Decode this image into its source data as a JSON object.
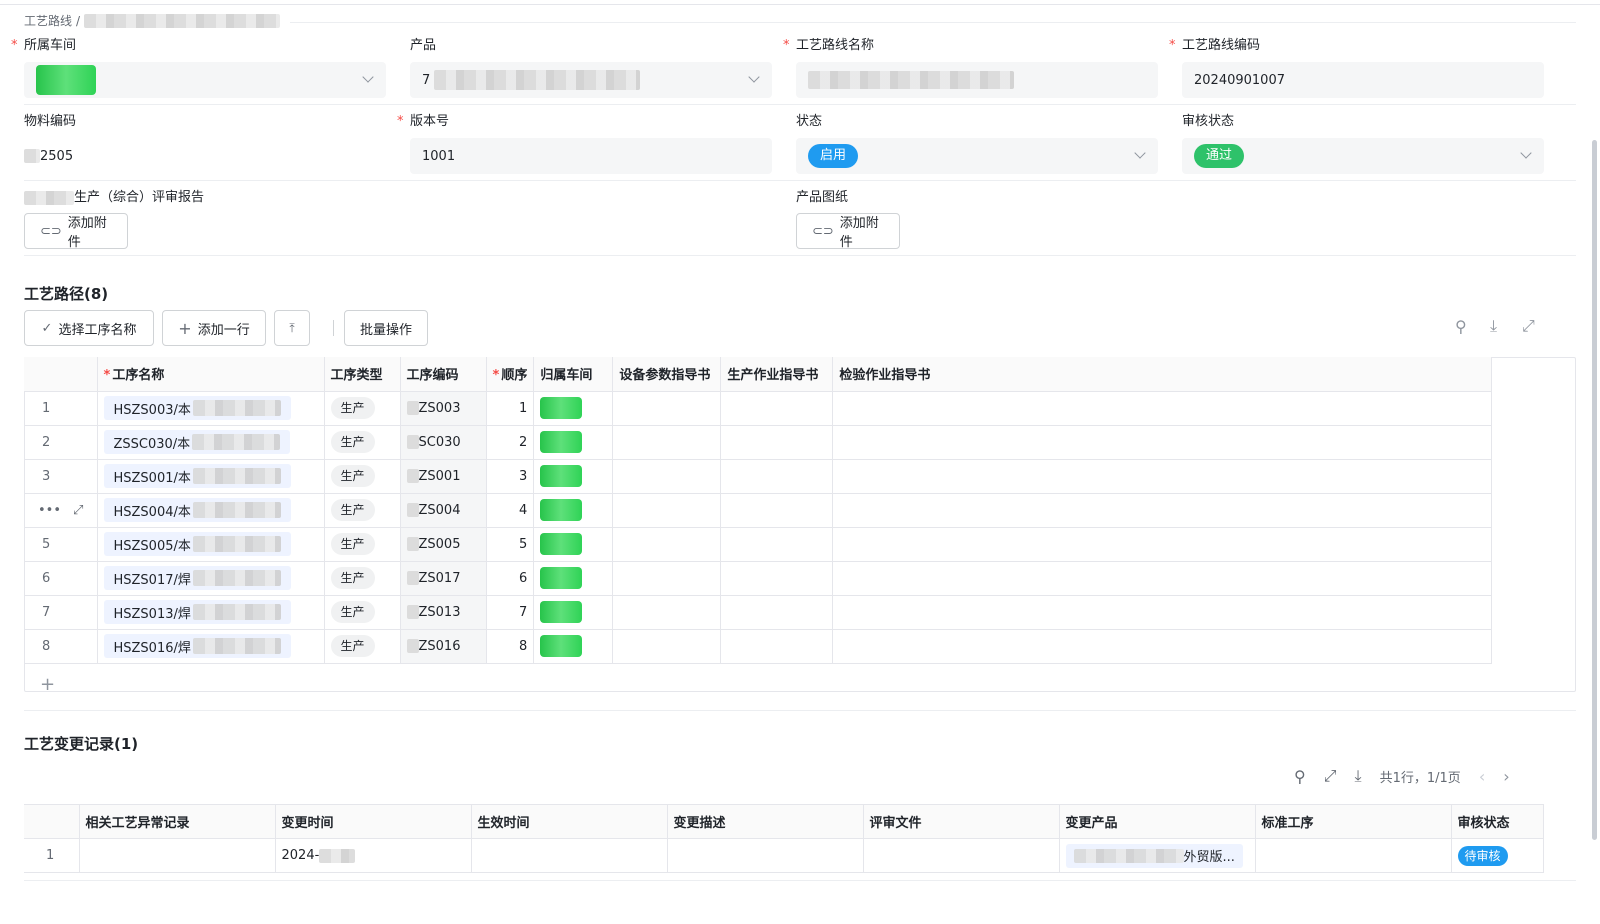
{
  "breadcrumb": {
    "root": "工艺路线",
    "separator": "/"
  },
  "form": {
    "workshop": {
      "label": "所属车间",
      "required": true
    },
    "product": {
      "label": "产品",
      "value_prefix": "7",
      "required": false
    },
    "route_name": {
      "label": "工艺路线名称",
      "required": true
    },
    "route_code": {
      "label": "工艺路线编码",
      "value": "20240901007",
      "required": true
    },
    "material_code": {
      "label": "物料编码",
      "value": "2505"
    },
    "version": {
      "label": "版本号",
      "value": "1001",
      "required": true
    },
    "status": {
      "label": "状态",
      "value": "启用",
      "color": "#1f9bf0"
    },
    "audit_status": {
      "label": "审核状态",
      "value": "通过",
      "color": "#2ec26a"
    },
    "review_report": {
      "label": "生产（综合）评审报告",
      "button": "添加附件"
    },
    "drawing": {
      "label": "产品图纸",
      "button": "添加附件"
    }
  },
  "route_section": {
    "title": "工艺路径(8)",
    "toolbar": {
      "select_process": "选择工序名称",
      "add_row": "添加一行",
      "batch": "批量操作"
    },
    "columns": [
      "工序名称",
      "工序类型",
      "工序编码",
      "顺序",
      "归属车间",
      "设备参数指导书",
      "生产作业指导书",
      "检验作业指导书"
    ],
    "rows": [
      {
        "index": "1",
        "name": "HSZS003/本",
        "type": "生产",
        "code": "ZS003",
        "order": "1"
      },
      {
        "index": "2",
        "name": "ZSSC030/本",
        "type": "生产",
        "code": "SC030",
        "order": "2"
      },
      {
        "index": "3",
        "name": "HSZS001/本",
        "type": "生产",
        "code": "ZS001",
        "order": "3"
      },
      {
        "index": "",
        "name": "HSZS004/本",
        "type": "生产",
        "code": "ZS004",
        "order": "4"
      },
      {
        "index": "5",
        "name": "HSZS005/本",
        "type": "生产",
        "code": "ZS005",
        "order": "5"
      },
      {
        "index": "6",
        "name": "HSZS017/焊",
        "type": "生产",
        "code": "ZS017",
        "order": "6"
      },
      {
        "index": "7",
        "name": "HSZS013/焊",
        "type": "生产",
        "code": "ZS013",
        "order": "7"
      },
      {
        "index": "8",
        "name": "HSZS016/焊",
        "type": "生产",
        "code": "ZS016",
        "order": "8"
      }
    ],
    "add_row_icon": "plus-icon"
  },
  "change_section": {
    "title": "工艺变更记录(1)",
    "pagination": "共1行，1/1页",
    "columns": [
      "相关工艺异常记录",
      "变更时间",
      "生效时间",
      "变更描述",
      "评审文件",
      "变更产品",
      "标准工序",
      "审核状态"
    ],
    "rows": [
      {
        "index": "1",
        "time_prefix": "2024-",
        "product_suffix": "外贸版...",
        "audit": "待审核"
      }
    ],
    "audit_color": "#1f9bf0"
  }
}
